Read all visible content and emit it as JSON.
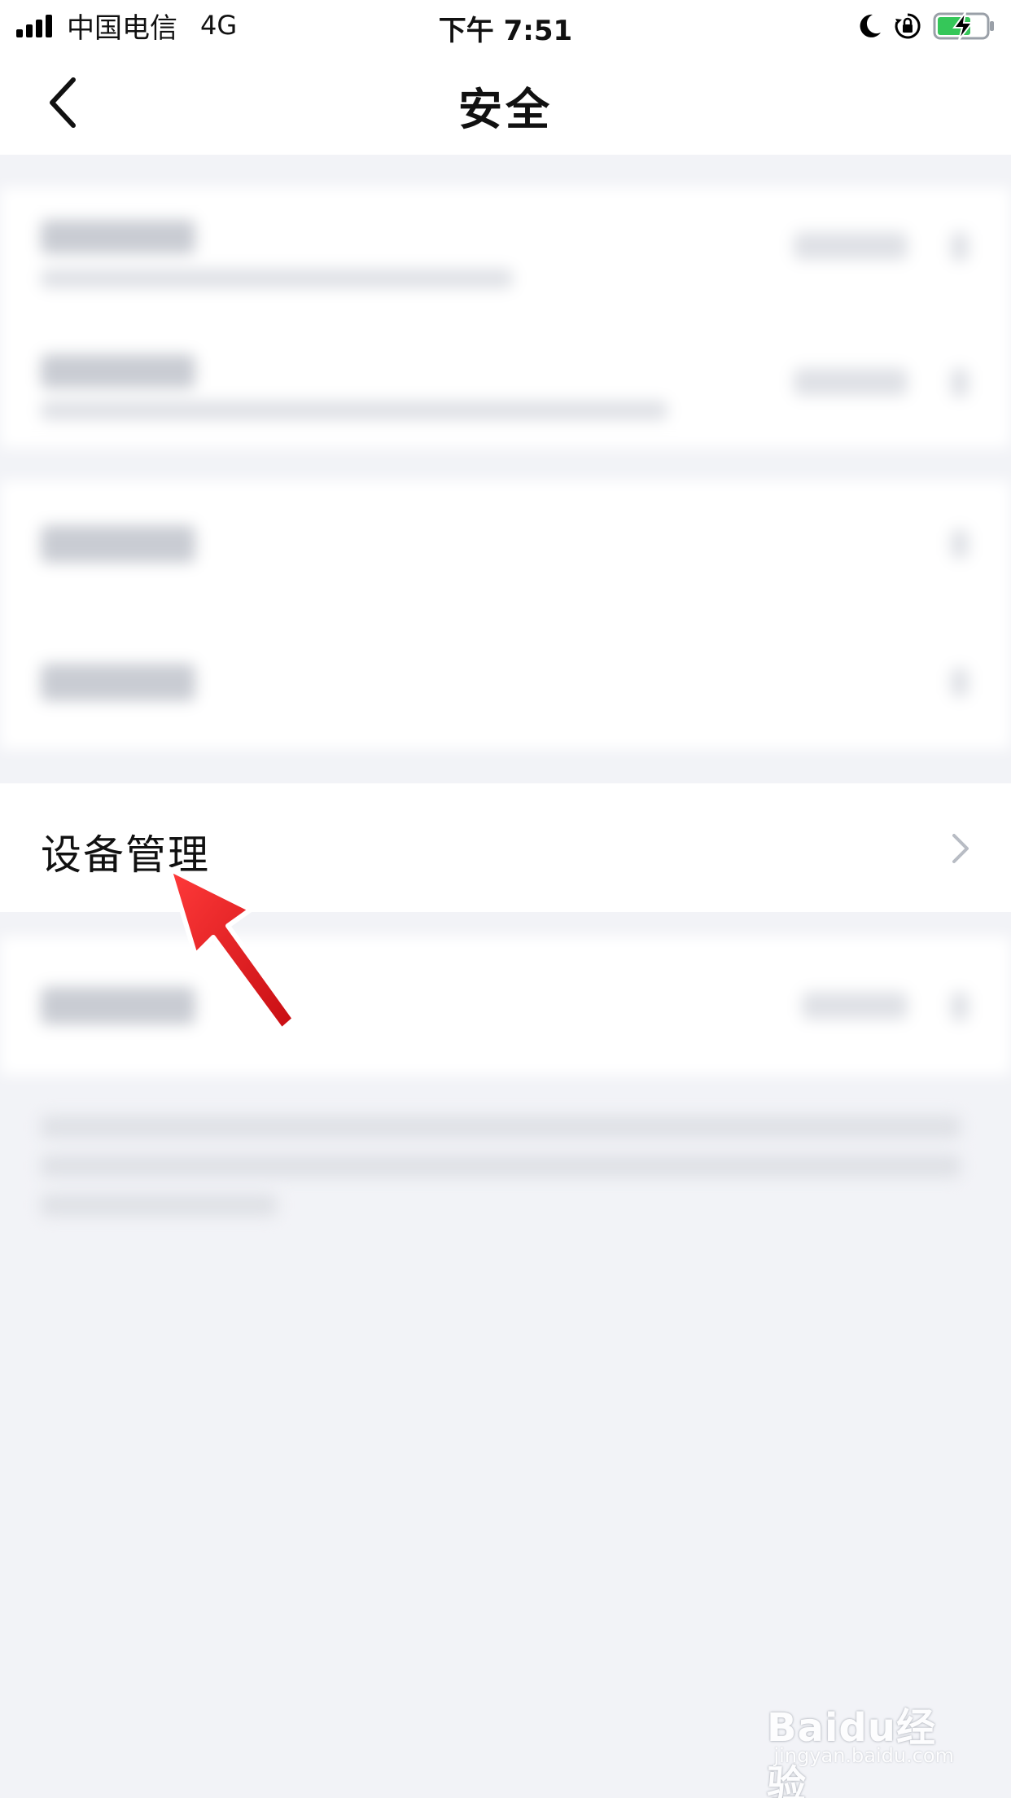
{
  "status_bar": {
    "carrier": "中国电信",
    "network": "4G",
    "time": "下午 7:51"
  },
  "nav": {
    "title": "安全"
  },
  "device_management": {
    "label": "设备管理"
  },
  "watermark": {
    "brand": "Baidu经验",
    "url": "jingyan.baidu.com"
  },
  "colors": {
    "background": "#f2f3f7",
    "surface": "#ffffff",
    "arrow": "#e8161b"
  }
}
